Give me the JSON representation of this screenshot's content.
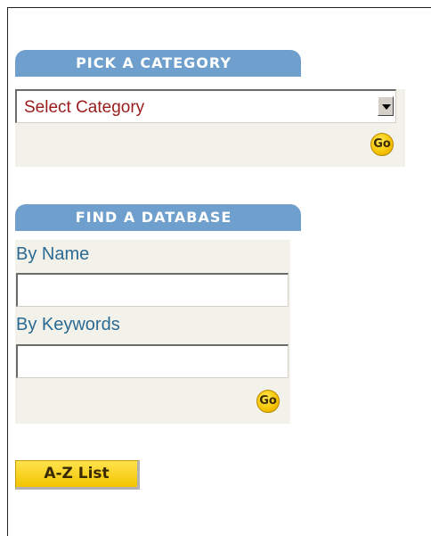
{
  "category_section": {
    "header": "PICK A CATEGORY",
    "select_value": "Select Category",
    "go_label": "Go"
  },
  "database_section": {
    "header": "FIND A DATABASE",
    "by_name_label": "By Name",
    "by_name_value": "",
    "by_keywords_label": "By Keywords",
    "by_keywords_value": "",
    "go_label": "Go"
  },
  "az_button": {
    "label": "A-Z List"
  },
  "colors": {
    "header_blue": "#6f9fcc",
    "panel_bg": "#f3f2ea",
    "label_blue": "#2b6a93",
    "select_text_red": "#9a1b1b",
    "button_yellow": "#f6c400"
  }
}
